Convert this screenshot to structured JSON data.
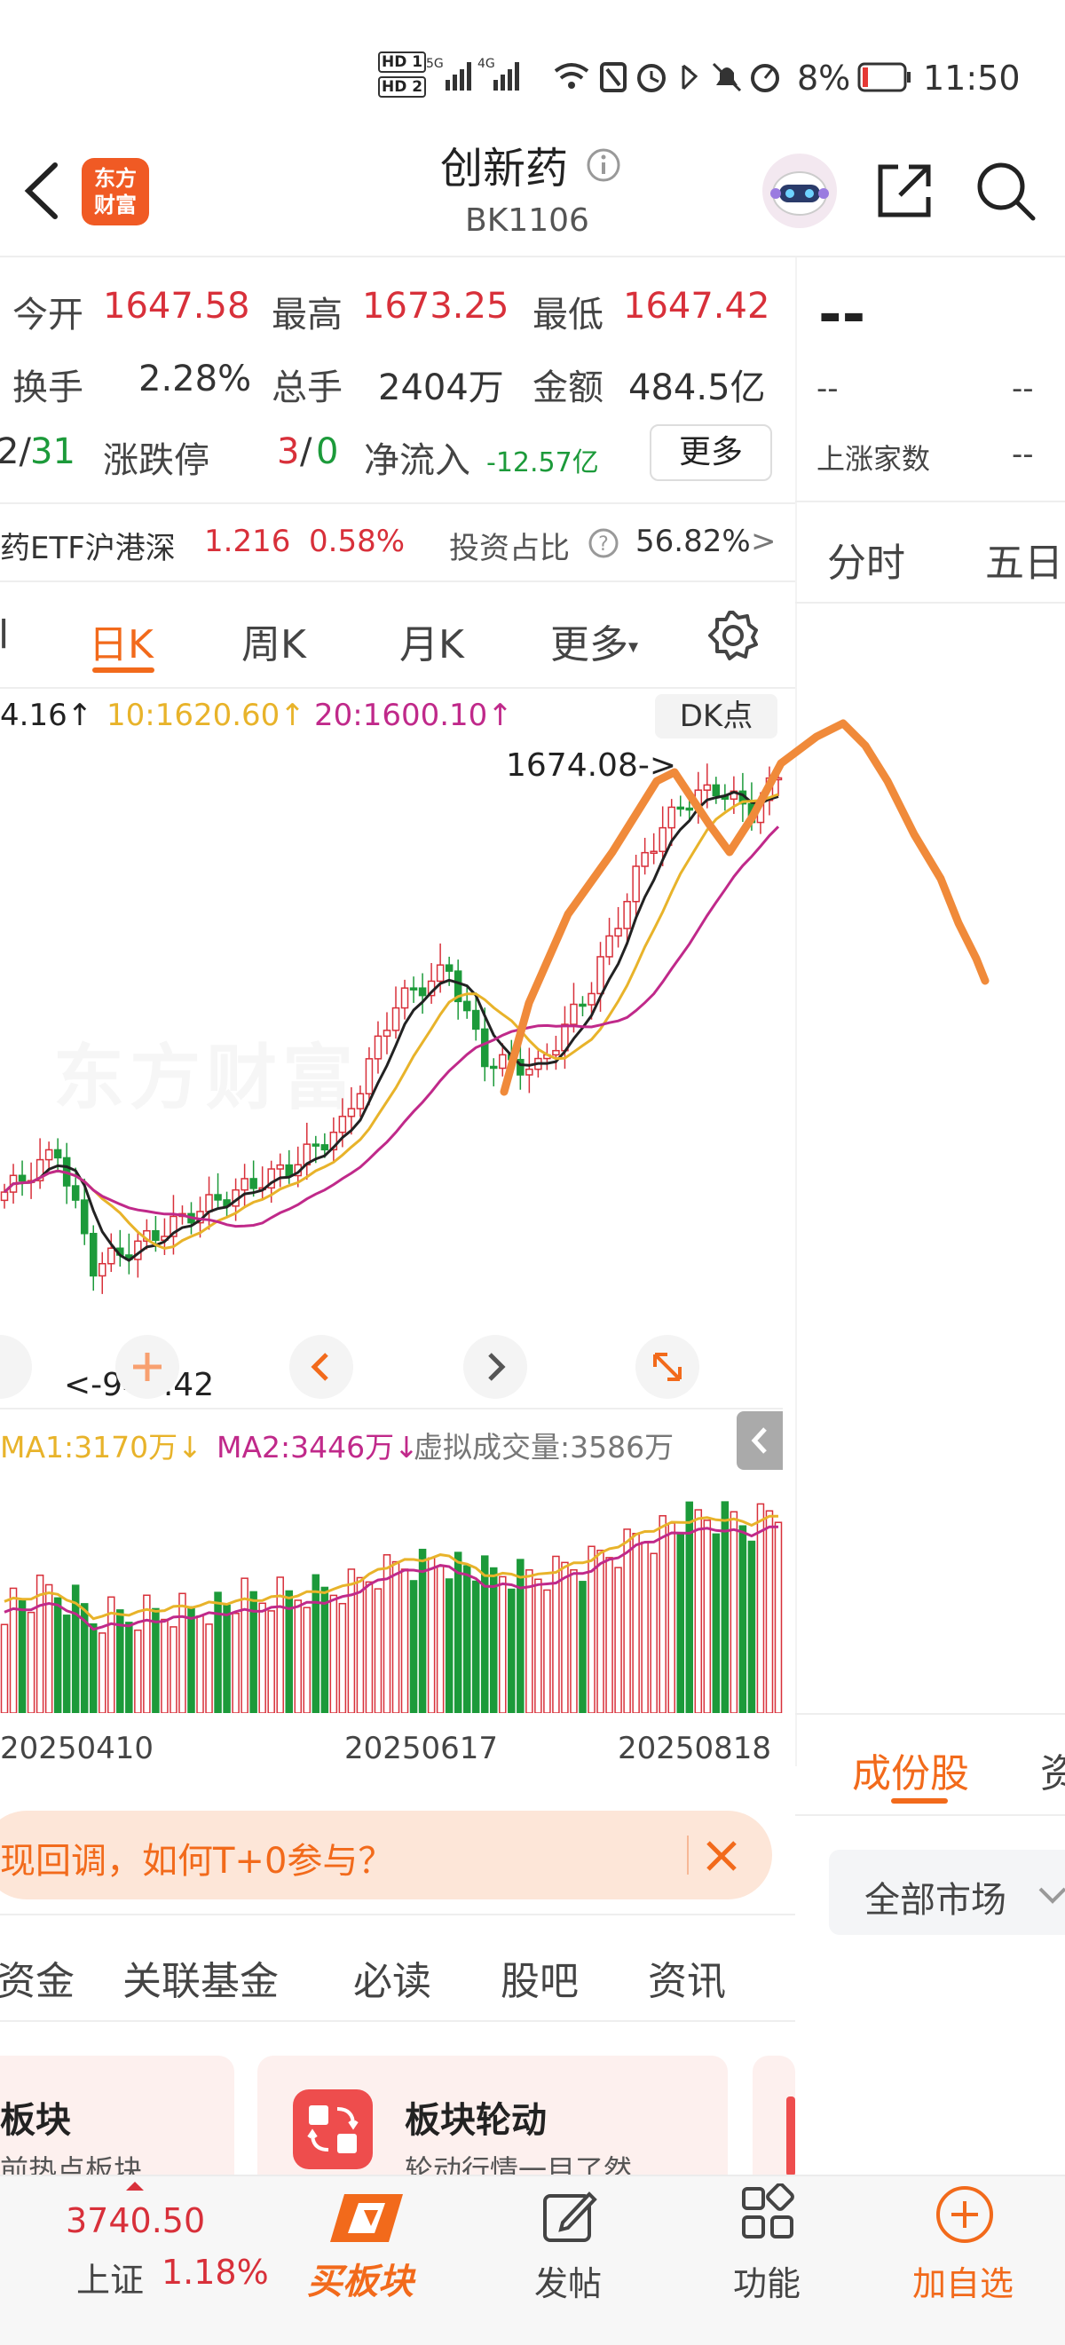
{
  "status_bar": {
    "hd1": "HD 1",
    "hd2": "HD 2",
    "sig1": "5G",
    "sig2": "4G",
    "battery": "8%",
    "time": "11:50"
  },
  "header": {
    "app_logo_line1": "东方",
    "app_logo_line2": "财富",
    "title": "创新药",
    "code": "BK1106"
  },
  "quote": {
    "open_label": "今开",
    "open_value": "1647.58",
    "high_label": "最高",
    "high_value": "1673.25",
    "low_label": "最低",
    "low_value": "1647.42",
    "turnover_label": "换手",
    "turnover_value": "2.28%",
    "volume_label": "总手",
    "volume_value": "2404万",
    "amount_label": "金额",
    "amount_value": "484.5亿",
    "updown_prefix": "2/",
    "updown_green": "31",
    "limit_label": "涨跌停",
    "limit_red": "3",
    "limit_sep": "/",
    "limit_green": "0",
    "netflow_label": "净流入",
    "netflow_value": "-12.57亿",
    "more_button": "更多"
  },
  "right_panel": {
    "big_dash": "--",
    "dash1": "--",
    "dash2": "--",
    "rise_count_label": "上涨家数",
    "rise_count_value": "--",
    "tab_fenshi": "分时",
    "tab_wuri": "五日"
  },
  "etf": {
    "name": "药ETF沪港深",
    "price": "1.216",
    "change": "0.58%",
    "ratio_label": "投资占比",
    "ratio_value": "56.82%",
    "arrow": ">"
  },
  "k_tabs": {
    "partial": "l",
    "day": "日K",
    "week": "周K",
    "month": "月K",
    "more": "更多"
  },
  "ma_line": {
    "ma5": "4.16↑",
    "ma10": "10:1620.60↑",
    "ma20": "20:1600.10↑",
    "dk": "DK点"
  },
  "chart": {
    "max_label": "1674.08->",
    "min_label": "<-942.42",
    "watermark": "东方财富"
  },
  "volume_ma": {
    "ma1": "MA1:3170万↓",
    "ma2": "MA2:3446万↓",
    "virtual": "虚拟成交量:3586万"
  },
  "dates": [
    "20250410",
    "20250617",
    "20250818"
  ],
  "banner": {
    "text": "现回调，如何T+0参与？"
  },
  "sub_tabs": [
    "资金",
    "关联基金",
    "必读",
    "股吧",
    "资讯"
  ],
  "cards": {
    "card1_title": "板块",
    "card1_sub": "前热点板块",
    "card2_title": "板块轮动",
    "card2_sub": "轮动行情一目了然"
  },
  "right_lower": {
    "tab_components": "成份股",
    "tab_partial": "资",
    "market_select": "全部市场"
  },
  "bottom_nav": {
    "index_value": "3740.50",
    "index_name": "上证",
    "index_change": "1.18%",
    "buy_label": "买板块",
    "post_label": "发帖",
    "func_label": "功能",
    "add_label": "加自选"
  },
  "chart_data": {
    "type": "candlestick",
    "ma_periods": [
      5,
      10,
      20
    ],
    "annotated_high": 1674.08,
    "annotated_low": 942.42,
    "x_tick_labels": [
      "20250410",
      "20250617",
      "20250818"
    ],
    "colors": {
      "up": "#d8303a",
      "down": "#1c9a3a",
      "ma5": "#222222",
      "ma10": "#e8b32a",
      "ma20": "#c0298a",
      "drawing": "#f08a3a"
    }
  },
  "accent": "#f26a1b"
}
